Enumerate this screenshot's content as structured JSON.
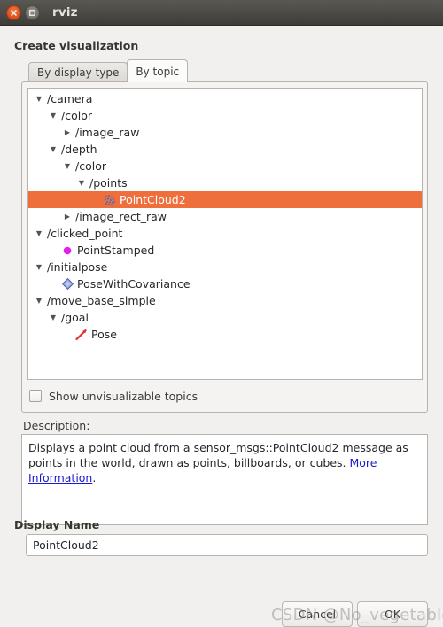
{
  "window": {
    "title": "rviz",
    "close_icon": "close-icon",
    "maximize_icon": "maximize-icon"
  },
  "dialog": {
    "heading": "Create visualization",
    "description_label": "Description:",
    "display_name_heading": "Display Name"
  },
  "tabs": [
    {
      "label": "By display type",
      "active": false
    },
    {
      "label": "By topic",
      "active": true
    }
  ],
  "tree": {
    "nodes": [
      {
        "label": "/camera",
        "depth": 0,
        "twisty": "expanded",
        "icon": "none",
        "selected": false
      },
      {
        "label": "/color",
        "depth": 1,
        "twisty": "expanded",
        "icon": "none",
        "selected": false
      },
      {
        "label": "/image_raw",
        "depth": 2,
        "twisty": "collapsed",
        "icon": "none",
        "selected": false
      },
      {
        "label": "/depth",
        "depth": 1,
        "twisty": "expanded",
        "icon": "none",
        "selected": false
      },
      {
        "label": "/color",
        "depth": 2,
        "twisty": "expanded",
        "icon": "none",
        "selected": false
      },
      {
        "label": "/points",
        "depth": 3,
        "twisty": "expanded",
        "icon": "none",
        "selected": false
      },
      {
        "label": "PointCloud2",
        "depth": 4,
        "twisty": "none",
        "icon": "pointcloud-icon",
        "selected": true
      },
      {
        "label": "/image_rect_raw",
        "depth": 2,
        "twisty": "collapsed",
        "icon": "none",
        "selected": false
      },
      {
        "label": "/clicked_point",
        "depth": 0,
        "twisty": "expanded",
        "icon": "none",
        "selected": false
      },
      {
        "label": "PointStamped",
        "depth": 1,
        "twisty": "none",
        "icon": "point-icon",
        "selected": false
      },
      {
        "label": "/initialpose",
        "depth": 0,
        "twisty": "expanded",
        "icon": "none",
        "selected": false
      },
      {
        "label": "PoseWithCovariance",
        "depth": 1,
        "twisty": "none",
        "icon": "covariance-icon",
        "selected": false
      },
      {
        "label": "/move_base_simple",
        "depth": 0,
        "twisty": "expanded",
        "icon": "none",
        "selected": false
      },
      {
        "label": "/goal",
        "depth": 1,
        "twisty": "expanded",
        "icon": "none",
        "selected": false
      },
      {
        "label": "Pose",
        "depth": 2,
        "twisty": "none",
        "icon": "pose-arrow-icon",
        "selected": false
      }
    ]
  },
  "show_unvisualizable": {
    "label": "Show unvisualizable topics",
    "checked": false
  },
  "description": {
    "text_before_link": "Displays a point cloud from a sensor_msgs::PointCloud2 message as points in the world, drawn as points, billboards, or cubes. ",
    "link_text": "More Information",
    "text_after_link": "."
  },
  "display_name": {
    "value": "PointCloud2",
    "placeholder": "Display Name"
  },
  "buttons": {
    "cancel_label": "Cancel",
    "ok_label": "OK"
  },
  "watermark": {
    "text": "CSDN @No_vegetable"
  },
  "colors": {
    "selection": "#ef6f3c",
    "titlebar": "#4b4945",
    "body": "#f1f0ee",
    "link": "#1a1ad0",
    "point_icon": "#e81ee8",
    "pose_arrow": "#e03028",
    "covariance": "#7f93d8"
  }
}
